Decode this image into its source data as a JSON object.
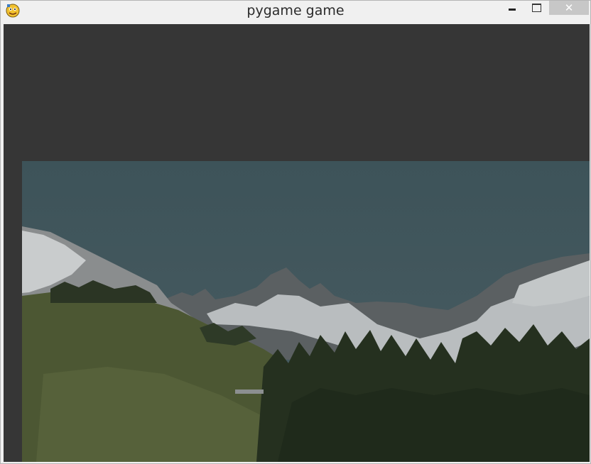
{
  "window": {
    "title": "pygame game",
    "icon": "pygame-snake-icon",
    "controls": {
      "minimize_icon": "minimize-icon",
      "maximize_icon": "maximize-icon",
      "close_label": "✕"
    }
  },
  "game": {
    "background_color": "#363636",
    "scene": "mountain-landscape-image"
  },
  "colors": {
    "sky": "#3e5258",
    "snow": "#c8cbcc",
    "rock": "#5a5d5e",
    "meadow": "#4a5532",
    "forest": "#263023"
  }
}
